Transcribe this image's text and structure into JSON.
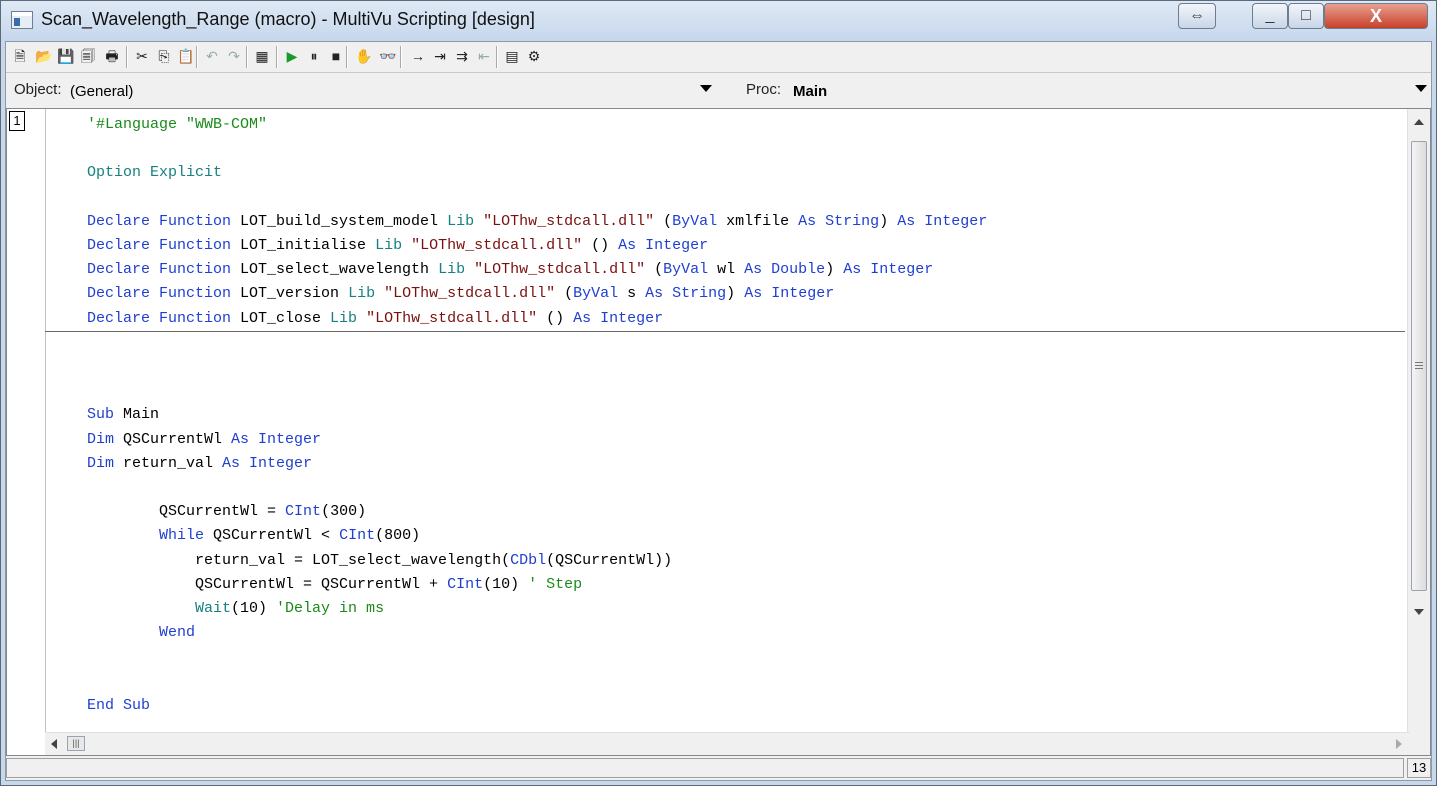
{
  "window": {
    "title": "Scan_Wavelength_Range (macro) - MultiVu Scripting [design]",
    "buttons": {
      "restore_symbol": "⇔",
      "minimize_symbol": "_",
      "maximize_symbol": "□",
      "close_symbol": "X"
    }
  },
  "toolbar": {
    "items": [
      {
        "name": "new-icon",
        "glyph": "🗎"
      },
      {
        "name": "open-icon",
        "glyph": "📂"
      },
      {
        "name": "save-icon",
        "glyph": "💾"
      },
      {
        "name": "save-all-icon",
        "glyph": "🗐"
      },
      {
        "name": "print-icon",
        "glyph": "🖶"
      },
      {
        "name": "cut-icon",
        "glyph": "✂"
      },
      {
        "name": "copy-icon",
        "glyph": "⎘"
      },
      {
        "name": "paste-icon",
        "glyph": "📋"
      },
      {
        "name": "undo-icon",
        "glyph": "↶"
      },
      {
        "name": "redo-icon",
        "glyph": "↷"
      },
      {
        "name": "dialog-editor-icon",
        "glyph": "▦"
      },
      {
        "name": "run-icon",
        "glyph": "▶"
      },
      {
        "name": "pause-icon",
        "glyph": "⏸"
      },
      {
        "name": "stop-icon",
        "glyph": "■"
      },
      {
        "name": "toggle-breakpoint-icon",
        "glyph": "✋"
      },
      {
        "name": "quick-watch-icon",
        "glyph": "👓"
      },
      {
        "name": "step-next-icon",
        "glyph": "→"
      },
      {
        "name": "step-into-icon",
        "glyph": "⇥"
      },
      {
        "name": "step-over-icon",
        "glyph": "⇉"
      },
      {
        "name": "step-out-icon",
        "glyph": "⇤"
      },
      {
        "name": "references-icon",
        "glyph": "▤"
      },
      {
        "name": "properties-icon",
        "glyph": "⚙"
      }
    ]
  },
  "selectors": {
    "object_label": "Object:",
    "object_value": "(General)",
    "proc_label": "Proc:",
    "proc_value": "Main"
  },
  "editor": {
    "line_number": "1",
    "lines": [
      [
        {
          "t": "'#Language \"WWB-COM\"",
          "c": "cm"
        }
      ],
      [],
      [
        {
          "t": "Option Explicit",
          "c": "teal"
        }
      ],
      [],
      [
        {
          "t": "Declare Function ",
          "c": "kw"
        },
        {
          "t": "LOT_build_system_model ",
          "c": "def"
        },
        {
          "t": "Lib ",
          "c": "teal"
        },
        {
          "t": "\"LOThw_stdcall.dll\" ",
          "c": "str"
        },
        {
          "t": "(",
          "c": "def"
        },
        {
          "t": "ByVal ",
          "c": "kw"
        },
        {
          "t": "xmlfile ",
          "c": "def"
        },
        {
          "t": "As String",
          "c": "kw"
        },
        {
          "t": ") ",
          "c": "def"
        },
        {
          "t": "As Integer",
          "c": "kw"
        }
      ],
      [
        {
          "t": "Declare Function ",
          "c": "kw"
        },
        {
          "t": "LOT_initialise ",
          "c": "def"
        },
        {
          "t": "Lib ",
          "c": "teal"
        },
        {
          "t": "\"LOThw_stdcall.dll\" ",
          "c": "str"
        },
        {
          "t": "() ",
          "c": "def"
        },
        {
          "t": "As Integer",
          "c": "kw"
        }
      ],
      [
        {
          "t": "Declare Function ",
          "c": "kw"
        },
        {
          "t": "LOT_select_wavelength ",
          "c": "def"
        },
        {
          "t": "Lib ",
          "c": "teal"
        },
        {
          "t": "\"LOThw_stdcall.dll\" ",
          "c": "str"
        },
        {
          "t": "(",
          "c": "def"
        },
        {
          "t": "ByVal ",
          "c": "kw"
        },
        {
          "t": "wl ",
          "c": "def"
        },
        {
          "t": "As Double",
          "c": "kw"
        },
        {
          "t": ") ",
          "c": "def"
        },
        {
          "t": "As Integer",
          "c": "kw"
        }
      ],
      [
        {
          "t": "Declare Function ",
          "c": "kw"
        },
        {
          "t": "LOT_version ",
          "c": "def"
        },
        {
          "t": "Lib ",
          "c": "teal"
        },
        {
          "t": "\"LOThw_stdcall.dll\" ",
          "c": "str"
        },
        {
          "t": "(",
          "c": "def"
        },
        {
          "t": "ByVal ",
          "c": "kw"
        },
        {
          "t": "s ",
          "c": "def"
        },
        {
          "t": "As String",
          "c": "kw"
        },
        {
          "t": ") ",
          "c": "def"
        },
        {
          "t": "As Integer",
          "c": "kw"
        }
      ],
      [
        {
          "t": "Declare Function ",
          "c": "kw"
        },
        {
          "t": "LOT_close ",
          "c": "def"
        },
        {
          "t": "Lib ",
          "c": "teal"
        },
        {
          "t": "\"LOThw_stdcall.dll\" ",
          "c": "str"
        },
        {
          "t": "() ",
          "c": "def"
        },
        {
          "t": "As Integer",
          "c": "kw"
        }
      ],
      [],
      [],
      [],
      [
        {
          "t": "Sub ",
          "c": "kw"
        },
        {
          "t": "Main",
          "c": "def"
        }
      ],
      [
        {
          "t": "Dim ",
          "c": "kw"
        },
        {
          "t": "QSCurrentWl ",
          "c": "def"
        },
        {
          "t": "As Integer",
          "c": "kw"
        }
      ],
      [
        {
          "t": "Dim ",
          "c": "kw"
        },
        {
          "t": "return_val ",
          "c": "def"
        },
        {
          "t": "As Integer",
          "c": "kw"
        }
      ],
      [],
      [
        {
          "t": "        QSCurrentWl = ",
          "c": "def"
        },
        {
          "t": "CInt",
          "c": "kw"
        },
        {
          "t": "(300)",
          "c": "def"
        }
      ],
      [
        {
          "t": "        While ",
          "c": "kw"
        },
        {
          "t": "QSCurrentWl < ",
          "c": "def"
        },
        {
          "t": "CInt",
          "c": "kw"
        },
        {
          "t": "(800)",
          "c": "def"
        }
      ],
      [
        {
          "t": "            return_val = LOT_select_wavelength(",
          "c": "def"
        },
        {
          "t": "CDbl",
          "c": "kw"
        },
        {
          "t": "(QSCurrentWl))",
          "c": "def"
        }
      ],
      [
        {
          "t": "            QSCurrentWl = QSCurrentWl + ",
          "c": "def"
        },
        {
          "t": "CInt",
          "c": "kw"
        },
        {
          "t": "(10) ",
          "c": "def"
        },
        {
          "t": "' Step",
          "c": "cm"
        }
      ],
      [
        {
          "t": "            Wait",
          "c": "teal"
        },
        {
          "t": "(10) ",
          "c": "def"
        },
        {
          "t": "'Delay in ms",
          "c": "cm"
        }
      ],
      [
        {
          "t": "        Wend",
          "c": "kw"
        }
      ],
      [],
      [],
      [
        {
          "t": "End Sub",
          "c": "kw"
        }
      ]
    ]
  },
  "status": {
    "main_text": "",
    "line_indicator": "13"
  },
  "colors": {
    "keyword": "#1f3fd0",
    "string": "#7a1010",
    "comment": "#1a8a1a",
    "builtin": "#178080"
  }
}
